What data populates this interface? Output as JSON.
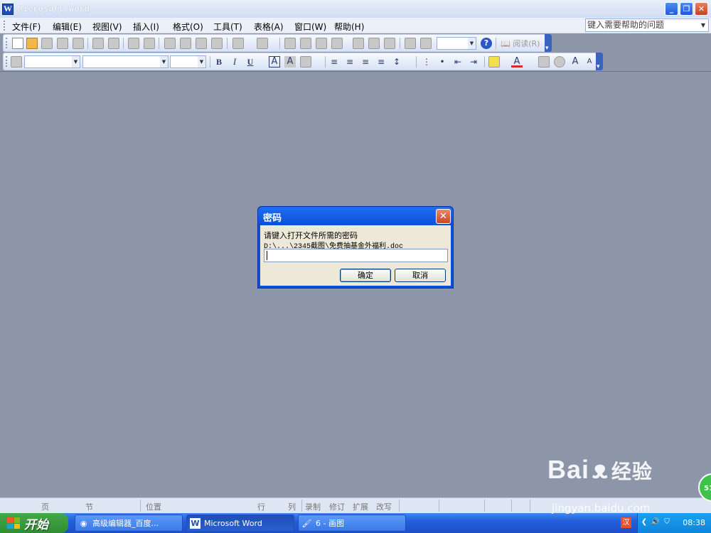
{
  "window": {
    "title": "Microsoft Word",
    "app_icon_letter": "W",
    "controls": [
      "minimize-icon",
      "restore-icon",
      "close-icon"
    ]
  },
  "menu": {
    "items": [
      "文件(F)",
      "编辑(E)",
      "视图(V)",
      "插入(I)",
      "格式(O)",
      "工具(T)",
      "表格(A)",
      "窗口(W)",
      "帮助(H)"
    ],
    "help_placeholder": "键入需要帮助的问题"
  },
  "toolbar": {
    "read_label": "阅读(R)"
  },
  "format_toolbar": {
    "bold": "B",
    "italic": "I",
    "underline": "U",
    "char_border": "A",
    "char_shading": "A",
    "font_color": "A"
  },
  "dialog": {
    "title": "密码",
    "prompt": "请键入打开文件所需的密码",
    "path": "D:\\...\\2345截图\\免费抽基金外福利.doc",
    "password_value": "",
    "ok_label": "确定",
    "cancel_label": "取消"
  },
  "statusbar": {
    "page": "页",
    "section": "节",
    "position": "位置",
    "line": "行",
    "column": "列",
    "record": "录制",
    "revise": "修订",
    "extend": "扩展",
    "overwrite": "改写"
  },
  "taskbar": {
    "start_label": "开始",
    "tasks": [
      {
        "label": "高级编辑器_百度...",
        "icon": "browser-icon"
      },
      {
        "label": "Microsoft Word",
        "icon": "word-icon"
      },
      {
        "label": "6 - 画图",
        "icon": "paint-icon"
      }
    ],
    "clock": "08:38"
  },
  "watermark": {
    "logo": "Bai",
    "logo_suffix": "经验",
    "url": "jingyan.baidu.com",
    "badge": "51"
  }
}
